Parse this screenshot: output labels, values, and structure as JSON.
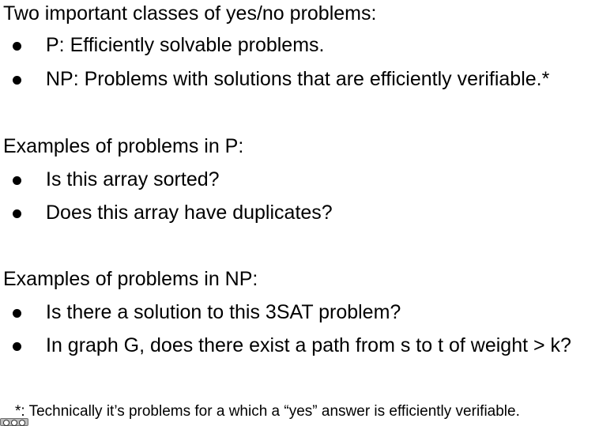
{
  "section1": {
    "heading": "Two important classes of yes/no problems:",
    "items": [
      "P: Efficiently solvable problems.",
      "NP: Problems with solutions that are efficiently verifiable.*"
    ]
  },
  "section2": {
    "heading": "Examples of problems in P:",
    "items": [
      "Is this array sorted?",
      "Does this array have duplicates?"
    ]
  },
  "section3": {
    "heading": "Examples of problems in NP:",
    "items": [
      "Is there a solution to this 3SAT problem?",
      "In graph G, does there exist a path from s to t of weight > k?"
    ]
  },
  "footnote": {
    "text": "*: Technically it’s problems for a which a “yes” answer is efficiently verifiable."
  },
  "badge": {
    "icon": "cc-license-icon"
  }
}
